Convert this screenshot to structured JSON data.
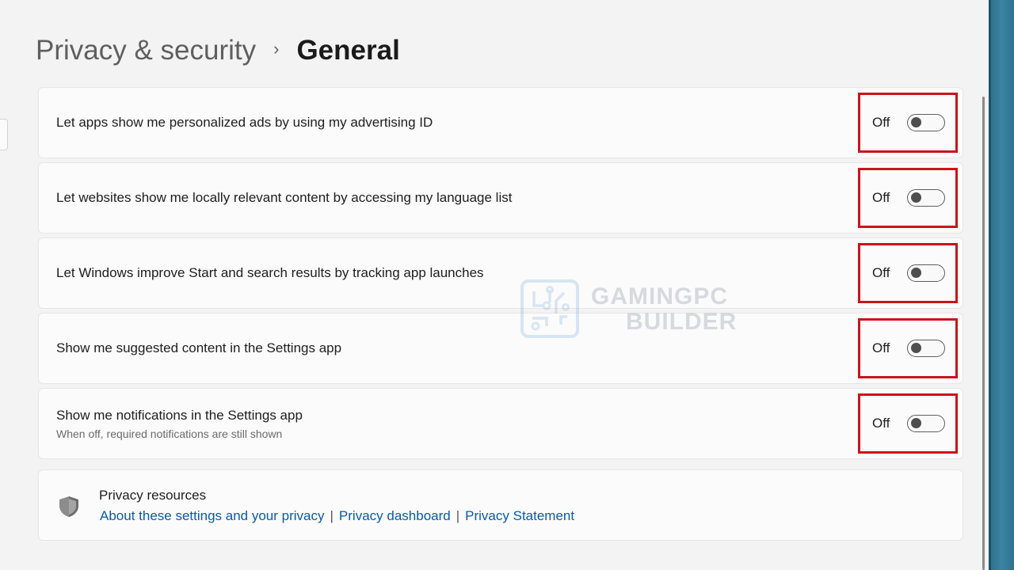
{
  "breadcrumb": {
    "parent": "Privacy & security",
    "separator": "›",
    "current": "General"
  },
  "settings": [
    {
      "label": "Let apps show me personalized ads by using my advertising ID",
      "description": "",
      "state_label": "Off",
      "on": false
    },
    {
      "label": "Let websites show me locally relevant content by accessing my language list",
      "description": "",
      "state_label": "Off",
      "on": false
    },
    {
      "label": "Let Windows improve Start and search results by tracking app launches",
      "description": "",
      "state_label": "Off",
      "on": false
    },
    {
      "label": "Show me suggested content in the Settings app",
      "description": "",
      "state_label": "Off",
      "on": false
    },
    {
      "label": "Show me notifications in the Settings app",
      "description": "When off, required notifications are still shown",
      "state_label": "Off",
      "on": false
    }
  ],
  "resources": {
    "title": "Privacy resources",
    "links": [
      "About these settings and your privacy",
      "Privacy dashboard",
      "Privacy Statement"
    ],
    "link_separator": "|"
  },
  "watermark": {
    "line1": "GAMINGPC",
    "line2": "BUILDER"
  },
  "colors": {
    "highlight": "#c9141c",
    "link": "#0b5aa6",
    "background": "#f3f3f3",
    "card": "#fbfbfb"
  }
}
